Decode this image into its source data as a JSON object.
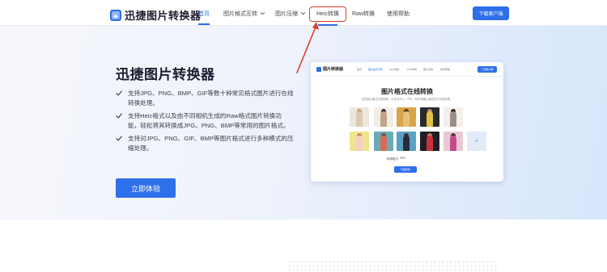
{
  "brand": {
    "name": "迅捷图片转换器",
    "accent": "#2e6fea",
    "highlight": "#d6412a"
  },
  "nav": {
    "items": [
      {
        "label": "首页",
        "active": true
      },
      {
        "label": "图片格式互转",
        "dropdown": true
      },
      {
        "label": "图片压缩",
        "dropdown": true
      },
      {
        "label": "Heic转换",
        "highlighted": true
      },
      {
        "label": "Raw转换"
      },
      {
        "label": "使用帮助"
      }
    ],
    "download_label": "下载客户端"
  },
  "hero": {
    "title": "迅捷图片转换器",
    "features": [
      "支持JPG、PNG、BMP、GIF等数十种常见格式图片进行在线转换处理。",
      "支持Heic格式以及由不同相机生成的Raw格式图片转换功能，轻松将其转换成JPG、PNG、BMP等常用的图片格式。",
      "支持对JPG、PNG、GIF、BMP等图片格式进行多种模式的压缩处理。"
    ],
    "cta_label": "立即体验",
    "check_icon": "check-icon"
  },
  "preview": {
    "logo": "图片转换器",
    "nav": [
      "首页",
      "图片格式互转",
      "Heic转换",
      "Raw转换",
      "图片压缩",
      "使用帮助"
    ],
    "download_label": "下载客户端",
    "title": "图片格式在线转换",
    "subtitle": "在线图片格式互相转换，可支持JPG、JPG、BMP等图片格式进行互转处理。",
    "format_label": "转换格式:",
    "format_value": "JPG",
    "convert_label": "开始转换",
    "add_icon": "plus-icon"
  }
}
